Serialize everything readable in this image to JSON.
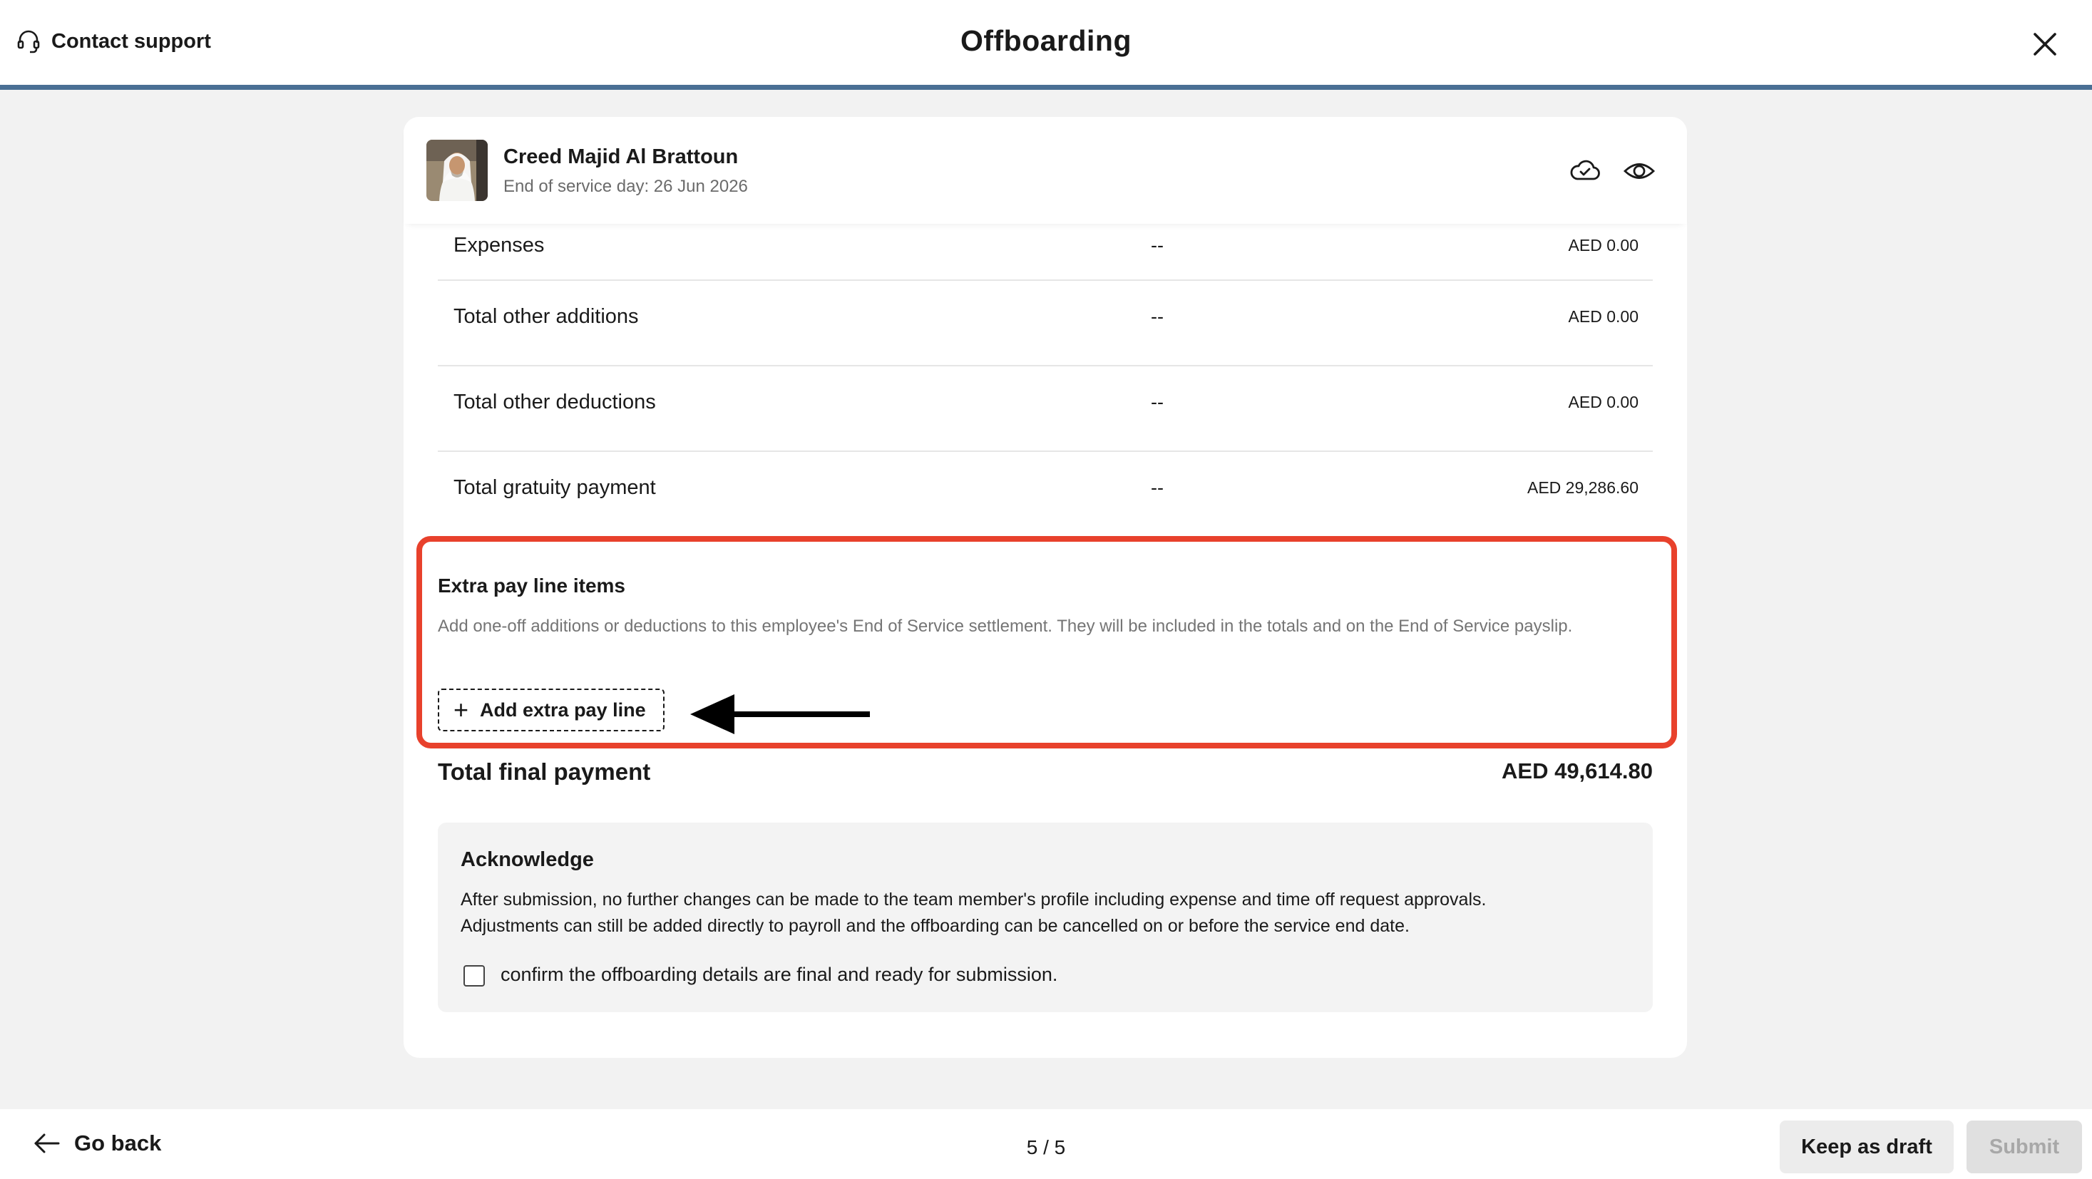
{
  "header": {
    "support_label": "Contact support",
    "title": "Offboarding",
    "accent_color": "#4a6f94"
  },
  "employee": {
    "name": "Creed Majid Al Brattoun",
    "subtitle": "End of service day: 26 Jun 2026",
    "icons": [
      "cloud-check-icon",
      "eye-icon"
    ]
  },
  "summary_rows": [
    {
      "label": "Expenses",
      "mid": "--",
      "amount": "AED 0.00"
    },
    {
      "label": "Total other additions",
      "mid": "--",
      "amount": "AED 0.00"
    },
    {
      "label": "Total other deductions",
      "mid": "--",
      "amount": "AED 0.00"
    },
    {
      "label": "Total gratuity payment",
      "mid": "--",
      "amount": "AED 29,286.60"
    }
  ],
  "extra_pay": {
    "title": "Extra pay line items",
    "description": "Add one-off additions or deductions to this employee's End of Service settlement. They will be included in the totals and on the End of Service payslip.",
    "add_button": "Add extra pay line",
    "highlight_color": "#e8412c"
  },
  "total": {
    "label": "Total final payment",
    "amount": "AED 49,614.80"
  },
  "acknowledge": {
    "title": "Acknowledge",
    "text_line1": "After submission, no further changes can be made to the team member's profile including expense and time off request approvals.",
    "text_line2": "Adjustments can still be added directly to payroll and the offboarding can be cancelled on or before the service end date.",
    "checkbox_label": "confirm the offboarding details are final and ready for submission.",
    "checked": false
  },
  "footer": {
    "go_back": "Go back",
    "pager": "5 / 5",
    "keep_draft": "Keep as draft",
    "submit": "Submit"
  }
}
